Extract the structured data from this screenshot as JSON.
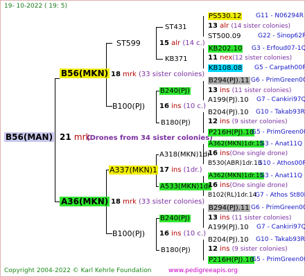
{
  "header": {
    "date": "19- 10-2022 ( 19: 5)"
  },
  "footer": {
    "copyright": "Copyright 2004-2022 © Karl Kehrle Foundation",
    "site": "www.pedigreeapis.org"
  },
  "colors": {
    "yellow": "#f2ee00",
    "green": "#2ee62e",
    "cyan": "#00d8ff",
    "gray": "#b0b0b0",
    "blue": "#1414c8",
    "red": "#b40000"
  },
  "root": {
    "name": "B56(MAN)",
    "gen": "21",
    "abbr": "mrk",
    "note": "(Drones from 34 sister colonies)"
  },
  "g1": {
    "top": {
      "name": "B56(MKN)",
      "gen": "18",
      "abbr": "mrk",
      "note": "(33 sister colonies)"
    },
    "bottom": {
      "name": "A36(MKN)",
      "gen": "18",
      "abbr": "mrk",
      "note": "(33 sister colonies)"
    }
  },
  "g2": {
    "st599": {
      "name": "ST599",
      "gen": "15",
      "abbr": "alr",
      "note": "(14 c.)"
    },
    "b100a": {
      "name": "B100(PJ)",
      "gen": "16",
      "abbr": "ins",
      "note": "(10 c.)"
    },
    "a337": {
      "name": "A337(MKN)1",
      "gen": "17",
      "abbr": "ins",
      "note": "(1dr.)"
    },
    "b100b": {
      "name": "B100(PJ)",
      "gen": "16",
      "abbr": "ins",
      "note": "(10 c.)"
    }
  },
  "g3": {
    "st431": {
      "name": "ST431"
    },
    "kb371": {
      "name": "KB371"
    },
    "b240a": {
      "name": "B240(PJ)"
    },
    "b180a": {
      "name": "B180(PJ)"
    },
    "a318": {
      "name": "A318(MKN)1dr"
    },
    "a533": {
      "name": "A533(MKN)1dr"
    },
    "b240b": {
      "name": "B240(PJ)"
    },
    "b180b": {
      "name": "B180(PJ)"
    }
  },
  "g3sub": {
    "st431": {
      "gen": "13",
      "abbr": "alr",
      "note": "(14 sister colonies)"
    },
    "kb371": {
      "gen": "11",
      "abbr": "nex",
      "note": "(12 sister colonies)"
    },
    "b240a": {
      "gen": "13",
      "abbr": "ins",
      "note": "(11 sister colonies)"
    },
    "b180a": {
      "gen": "12",
      "abbr": "ins",
      "note": "(9 sister colonies)"
    },
    "a318": {
      "gen": "16",
      "abbr": "ins",
      "note": "(One single drone)"
    },
    "a533": {
      "gen": "16",
      "abbr": "ins",
      "note": "(One single drone)"
    },
    "b240b": {
      "gen": "13",
      "abbr": "ins",
      "note": "(11 sister colonies)"
    },
    "b180b": {
      "gen": "12",
      "abbr": "ins",
      "note": "(9 sister colonies)"
    }
  },
  "g4": [
    {
      "name": "PS530.12",
      "code": "G11 - N06294R"
    },
    {
      "name": "ST500.09",
      "code": "G22 - Sinop62R"
    },
    {
      "name": "KB202.10",
      "code": "G3 - Erfoud07-1Q"
    },
    {
      "name": "KB108.08",
      "code": "G5 - Carpath00R"
    },
    {
      "name": "B294(PJ).11",
      "code": "G6 - PrimGreen00"
    },
    {
      "name": "A199(PJ).10",
      "code": "G7 - Cankiri97Q"
    },
    {
      "name": "B204(PJ).10",
      "code": "G10 - Takab93R"
    },
    {
      "name": "P216H(PJ).10",
      "code": "G5 - PrimGreen00"
    },
    {
      "name": "A362(MKN)1dr.15",
      "code": "G3 - Anat11Q"
    },
    {
      "name": "B530(ABR)1dr.13",
      "code": "G10 - Athos00R"
    },
    {
      "name": "A362(MKN)1dr.15",
      "code": "G3 - Anat11Q"
    },
    {
      "name": "B102(RL)1dr.14",
      "code": "G7 - Athos St80R"
    },
    {
      "name": "B294(PJ).11",
      "code": "G6 - PrimGreen00"
    },
    {
      "name": "A199(PJ).10",
      "code": "G7 - Cankiri97Q"
    },
    {
      "name": "B204(PJ).10",
      "code": "G10 - Takab93R"
    },
    {
      "name": "P216H(PJ).10",
      "code": "G5 - PrimGreen00"
    }
  ]
}
